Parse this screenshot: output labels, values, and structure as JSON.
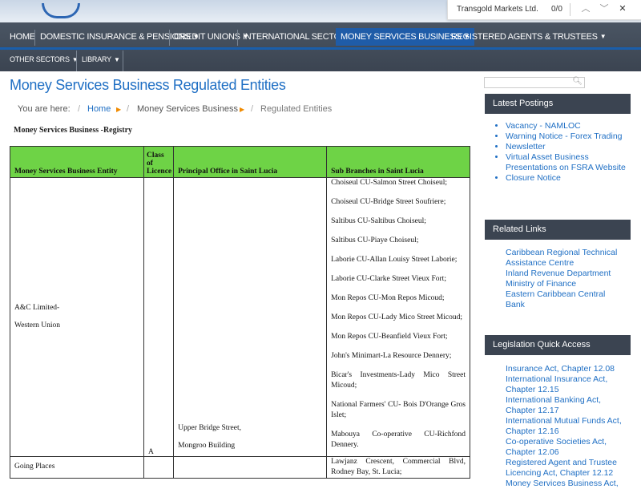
{
  "find_bar": {
    "query": "Transgold Markets Ltd.",
    "count": "0/0"
  },
  "nav": {
    "row1": [
      {
        "label": "HOME",
        "has_menu": false
      },
      {
        "label": "DOMESTIC INSURANCE & PENSIONS",
        "has_menu": true
      },
      {
        "label": "CREDIT UNIONS",
        "has_menu": true
      },
      {
        "label": "INTERNATIONAL SECTOR",
        "has_menu": true
      },
      {
        "label": "MONEY SERVICES BUSINESS",
        "has_menu": true,
        "active": true
      },
      {
        "label": "REGISTERED AGENTS & TRUSTEES",
        "has_menu": true
      }
    ],
    "row2": [
      {
        "label": "OTHER SECTORS",
        "has_menu": true
      },
      {
        "label": "LIBRARY",
        "has_menu": true
      }
    ]
  },
  "page": {
    "title": "Money Services Business Regulated Entities",
    "breadcrumb": {
      "prefix": "You are here:",
      "items": [
        "Home",
        "Money Services Business",
        "Regulated Entities"
      ]
    },
    "registry_heading": "Money Services Business -Registry"
  },
  "table": {
    "headers": [
      "Money Services Business Entity",
      "Class of Licence",
      "Principal Office in Saint Lucia",
      "Sub Branches in Saint Lucia"
    ],
    "rows": [
      {
        "entity_lines": [
          "A&C Limited-",
          "Western Union"
        ],
        "class": "A",
        "office_lines": [
          "Upper Bridge Street,",
          "Mongroo Building"
        ],
        "branches": [
          "Choiseul CU-Salmon Street Choiseul;",
          "Choiseul CU-Bridge Street Soufriere;",
          "Saltibus CU-Saltibus Choiseul;",
          "Saltibus CU-Piaye Choiseul;",
          "Laborie CU-Allan Louisy Street Laborie;",
          "Laborie CU-Clarke Street Vieux Fort;",
          "Mon Repos CU-Mon Repos Micoud;",
          "Mon Repos CU-Lady Mico Street Micoud;",
          "Mon Repos CU-Beanfield Vieux Fort;",
          "John's Minimart-La Resource Dennery;",
          "Bicar's Investments-Lady Mico Street Micoud;",
          "National Farmers' CU- Bois D'Orange Gros Islet;",
          "Mabouya Co-operative CU-Richfond Dennery."
        ]
      },
      {
        "entity_lines": [
          "Going Places"
        ],
        "class": "",
        "office_lines": [],
        "branches": [
          "Lawjanz Crescent, Commercial Blvd, Rodney Bay, St. Lucia;"
        ]
      }
    ]
  },
  "sidebar": {
    "latest_postings": {
      "title": "Latest Postings",
      "items": [
        "Vacancy - NAMLOC",
        "Warning Notice - Forex Trading",
        "Newsletter",
        "Virtual Asset Business Presentations on FSRA Website",
        "Closure Notice"
      ]
    },
    "related_links": {
      "title": "Related Links",
      "items": [
        "Caribbean Regional Technical Assistance Centre",
        "Inland Revenue Department",
        "Ministry of Finance",
        "Eastern Caribbean Central Bank"
      ]
    },
    "legislation": {
      "title": "Legislation Quick Access",
      "items": [
        "Insurance Act, Chapter 12.08",
        "International Insurance Act, Chapter 12.15",
        "International Banking Act, Chapter 12.17",
        "International Mutual Funds Act, Chapter 12.16",
        "Co-operative Societies Act, Chapter 12.06",
        "Registered Agent and Trustee Licencing Act, Chapter 12.12",
        "Money Services Business Act,"
      ]
    }
  },
  "colors": {
    "accent": "#1f6fc4",
    "nav_bg": "#3b4451",
    "active_nav": "#1f5ca8",
    "table_header": "#6ed346",
    "breadcrumb_arrow": "#f08a00"
  }
}
